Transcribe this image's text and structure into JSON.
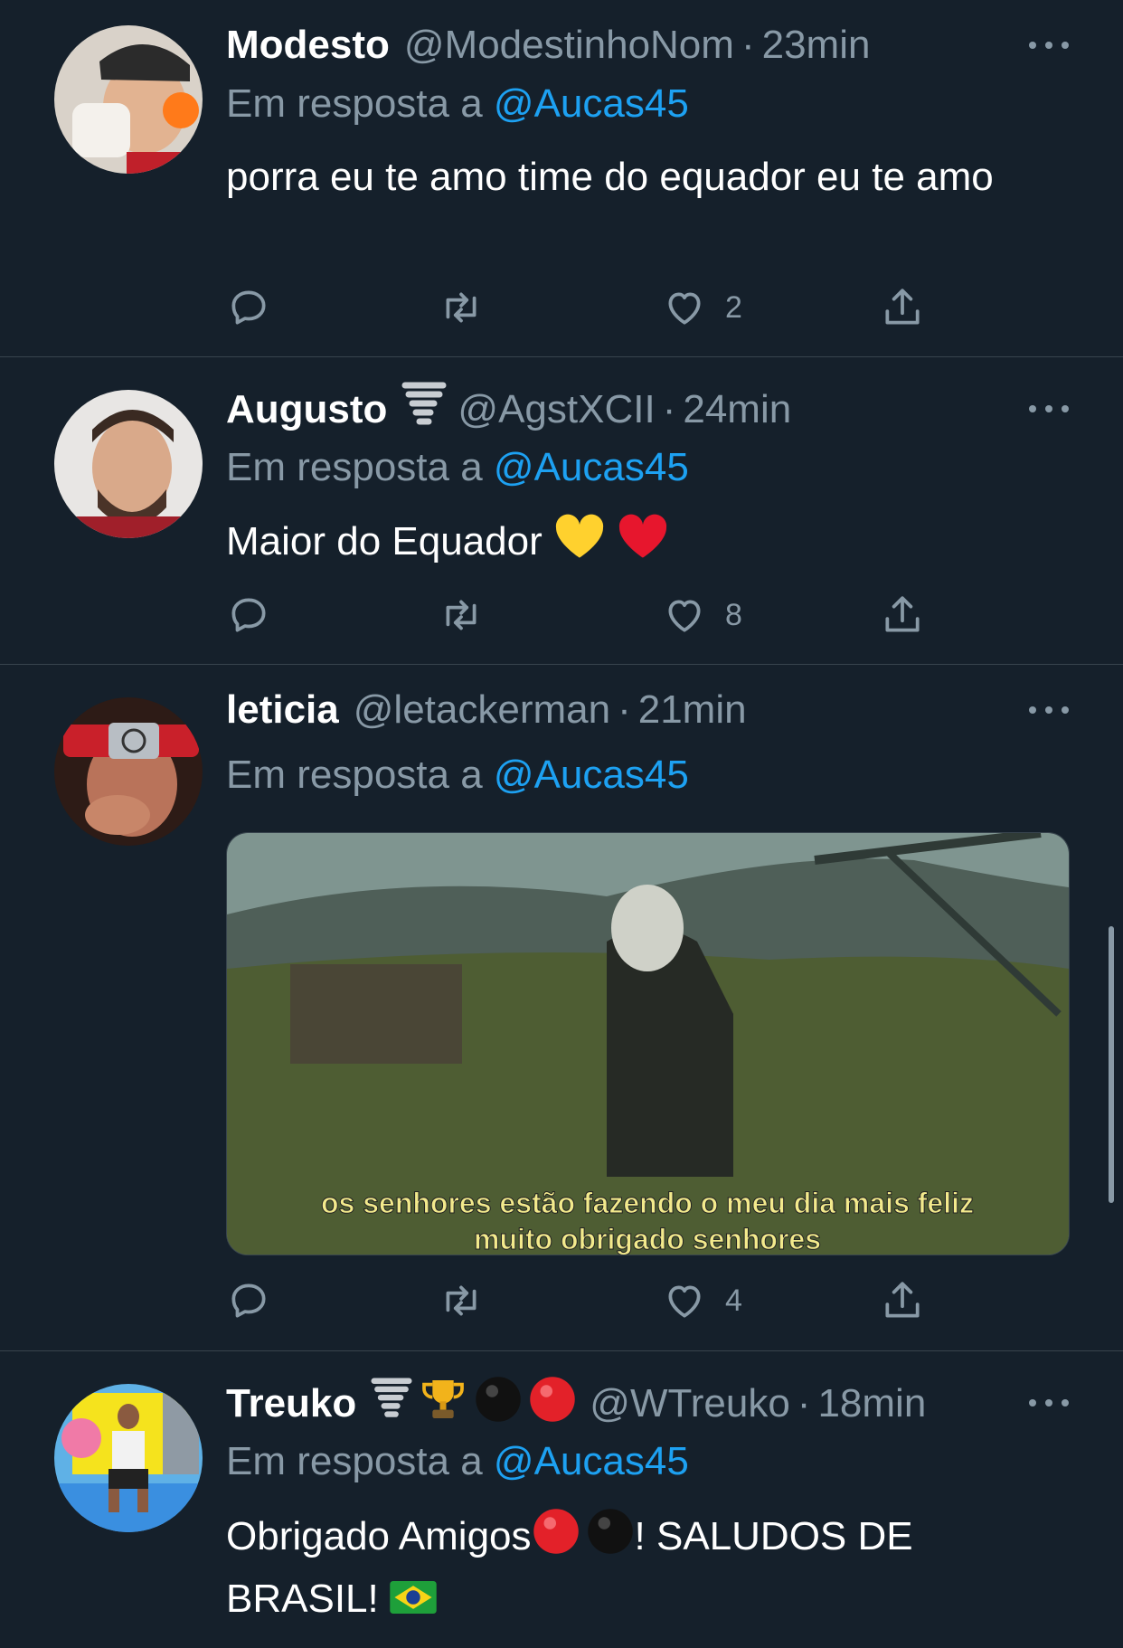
{
  "reply_prefix": "Em resposta a",
  "tweets": [
    {
      "name": "Modesto",
      "handle": "@ModestinhoNom",
      "time": "23min",
      "reply_to": "@Aucas45",
      "text": "porra eu te amo time do equador eu te amo",
      "likes": "2"
    },
    {
      "name": "Augusto",
      "handle": "@AgstXCII",
      "time": "24min",
      "reply_to": "@Aucas45",
      "text": "Maior do Equador",
      "likes": "8"
    },
    {
      "name": "leticia",
      "handle": "@letackerman",
      "time": "21min",
      "reply_to": "@Aucas45",
      "media_caption_line1": "os senhores estão fazendo o meu dia mais feliz",
      "media_caption_line2": "muito obrigado senhores",
      "likes": "4"
    },
    {
      "name": "Treuko",
      "handle": "@WTreuko",
      "time": "18min",
      "reply_to": "@Aucas45",
      "text_part1": "Obrigado Amigos",
      "text_part2": "! SALUDOS DE",
      "text_part3": "BRASIL!"
    }
  ],
  "colors": {
    "background": "#15202b",
    "secondary_text": "#8899a6",
    "link": "#1da1f2",
    "divider": "#38444d"
  }
}
